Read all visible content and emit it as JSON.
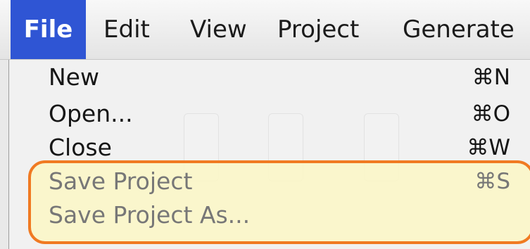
{
  "menubar": {
    "items": [
      {
        "label": "File"
      },
      {
        "label": "Edit"
      },
      {
        "label": "View"
      },
      {
        "label": "Project"
      },
      {
        "label": "Generate"
      }
    ]
  },
  "file_menu": {
    "items": [
      {
        "label": "New",
        "shortcut": "⌘N",
        "enabled": true
      },
      {
        "label": "Open...",
        "shortcut": "⌘O",
        "enabled": true
      },
      {
        "label": "Close",
        "shortcut": "⌘W",
        "enabled": true
      },
      {
        "label": "Save Project",
        "shortcut": "⌘S",
        "enabled": false
      },
      {
        "label": "Save Project As...",
        "shortcut": "",
        "enabled": false
      }
    ]
  },
  "highlight": {
    "color": "#f07a22",
    "fill": "#fbf7c5"
  },
  "colors": {
    "menu_active": "#2f55d4",
    "text": "#161616",
    "disabled_text": "#777777"
  }
}
